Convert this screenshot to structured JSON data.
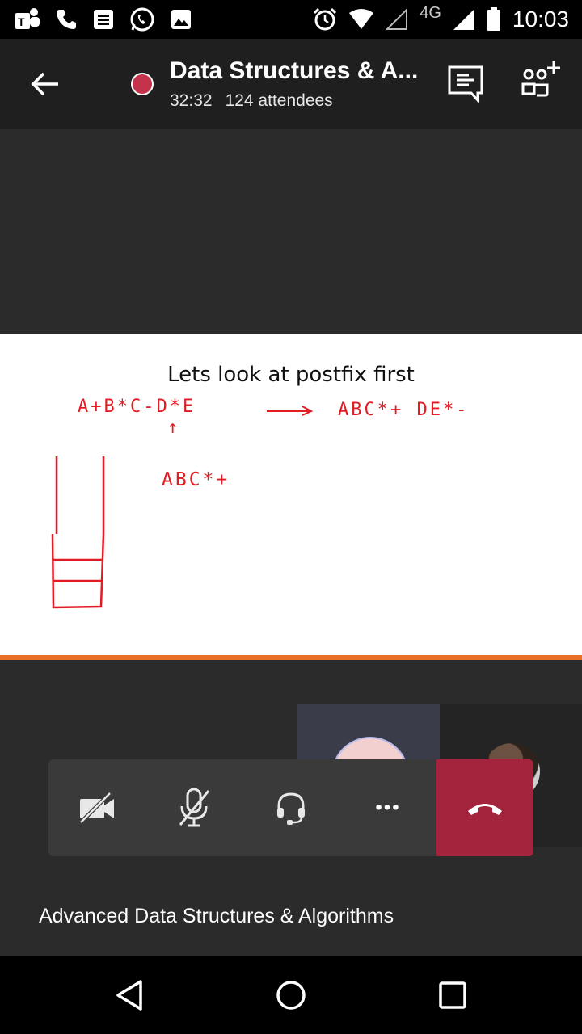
{
  "status_bar": {
    "network_label": "4G",
    "time": "10:03",
    "icons": [
      "teams-app-icon",
      "phone-icon",
      "message-icon",
      "whatsapp-icon",
      "gallery-icon",
      "alarm-icon",
      "wifi-icon",
      "signal-icon",
      "battery-icon"
    ]
  },
  "header": {
    "title": "Data Structures & A...",
    "duration": "32:32",
    "attendees": "124 attendees",
    "recording_color": "#c4314b"
  },
  "shared_screen": {
    "heading": "Lets look at postfix first",
    "notes": {
      "infix": "A+B*C-D*E",
      "postfix": "ABC*+ DE*-",
      "pointer": "↑",
      "partial": "ABC*+"
    },
    "border_color": "#e8702a"
  },
  "controls": {
    "camera": "camera-off-icon",
    "mic": "mic-off-icon",
    "audio": "headset-icon",
    "more_label": "•••",
    "hangup_color": "#a4233d"
  },
  "meeting_caption": "Advanced Data Structures & Algorithms"
}
